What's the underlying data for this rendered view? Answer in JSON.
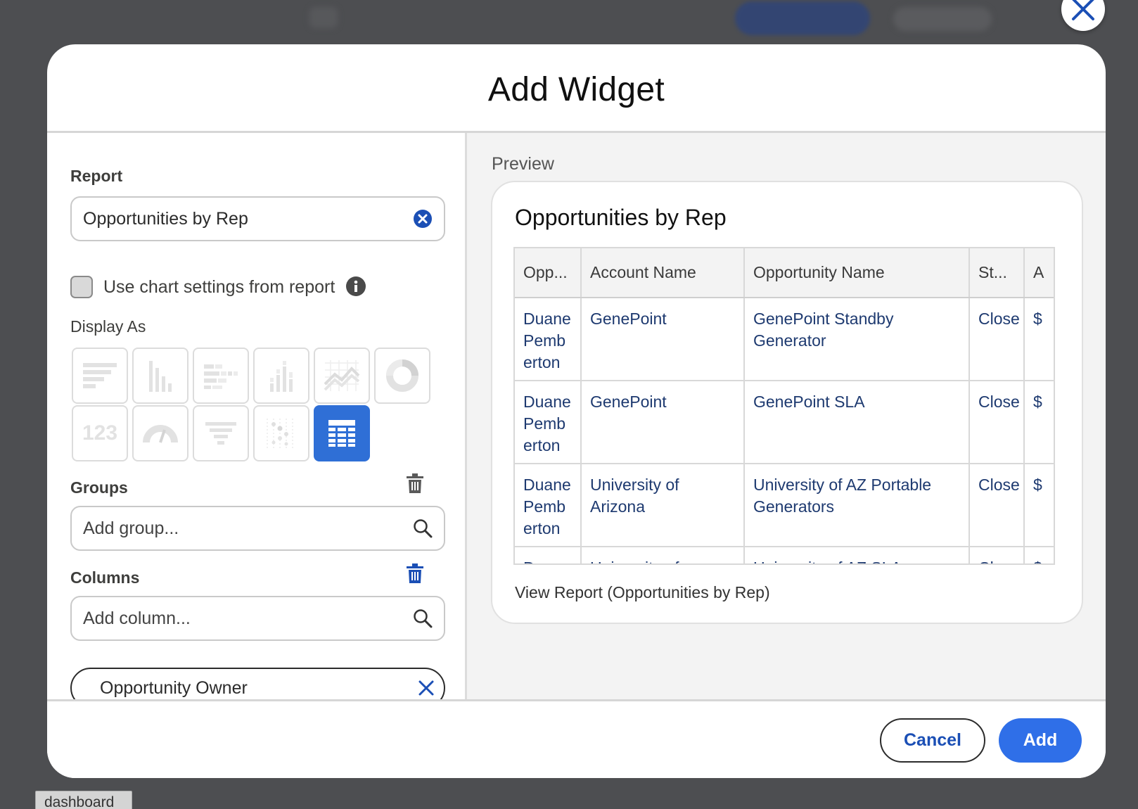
{
  "dialog": {
    "title": "Add Widget",
    "close_icon": "close-icon"
  },
  "left_panel": {
    "report_label": "Report",
    "report_value": "Opportunities by Rep",
    "use_chart_settings_label": "Use chart settings from report",
    "use_chart_settings_checked": false,
    "display_as_label": "Display As",
    "display_options": [
      {
        "icon": "horizontal-bar-chart-icon",
        "selected": false
      },
      {
        "icon": "vertical-bar-chart-icon",
        "selected": false
      },
      {
        "icon": "stacked-horizontal-bar-icon",
        "selected": false
      },
      {
        "icon": "stacked-vertical-bar-icon",
        "selected": false
      },
      {
        "icon": "line-chart-icon",
        "selected": false
      },
      {
        "icon": "donut-chart-icon",
        "selected": false
      },
      {
        "icon": "metric-icon",
        "label": "123",
        "selected": false
      },
      {
        "icon": "gauge-icon",
        "selected": false
      },
      {
        "icon": "funnel-icon",
        "selected": false
      },
      {
        "icon": "scatter-plot-icon",
        "selected": false
      },
      {
        "icon": "table-icon",
        "selected": true
      }
    ],
    "groups_label": "Groups",
    "groups_placeholder": "Add group...",
    "columns_label": "Columns",
    "columns_placeholder": "Add column...",
    "column_chips": [
      "Opportunity Owner"
    ]
  },
  "preview": {
    "label": "Preview",
    "card_title": "Opportunities by Rep",
    "columns": [
      "Opp...",
      "Account Name",
      "Opportunity Name",
      "St...",
      "A"
    ],
    "rows": [
      [
        "Duane Pemberton",
        "GenePoint",
        "GenePoint Standby Generator",
        "Close",
        "$"
      ],
      [
        "Duane Pemberton",
        "GenePoint",
        "GenePoint SLA",
        "Close",
        "$"
      ],
      [
        "Duane Pemberton",
        "University of Arizona",
        "University of AZ Portable Generators",
        "Close",
        "$"
      ],
      [
        "Duane Pemberton",
        "University of Arizona",
        "University of AZ SLA",
        "Close",
        "$"
      ]
    ],
    "view_report_link": "View Report (Opportunities by Rep)"
  },
  "footer": {
    "cancel_label": "Cancel",
    "add_label": "Add"
  },
  "background": {
    "tab_label": "dashboard"
  },
  "colors": {
    "accent": "#2f6fe8",
    "link": "#1b4fb5",
    "selected_tile": "#2f6fd6",
    "overlay": "#4d4e51"
  }
}
